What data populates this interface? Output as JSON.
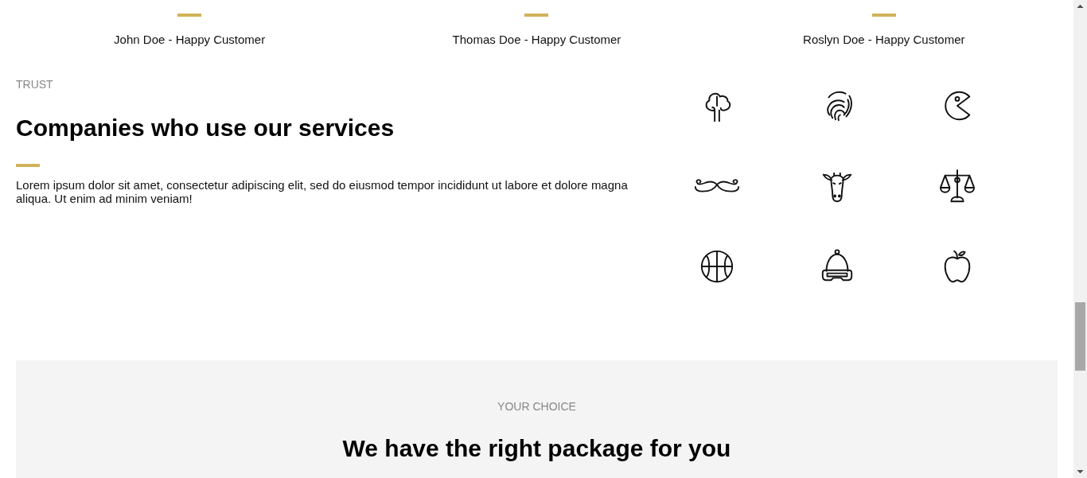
{
  "testimonials": [
    {
      "author": "John Doe - Happy Customer"
    },
    {
      "author": "Thomas Doe - Happy Customer"
    },
    {
      "author": "Roslyn Doe - Happy Customer"
    }
  ],
  "trust": {
    "eyebrow": "TRUST",
    "heading": "Companies who use our services",
    "text": "Lorem ipsum dolor sit amet, consectetur adipiscing elit, sed do eiusmod tempor incididunt ut labore et dolore magna aliqua. Ut enim ad minim veniam!"
  },
  "pricing": {
    "eyebrow": "YOUR CHOICE",
    "heading": "We have the right package for you"
  }
}
